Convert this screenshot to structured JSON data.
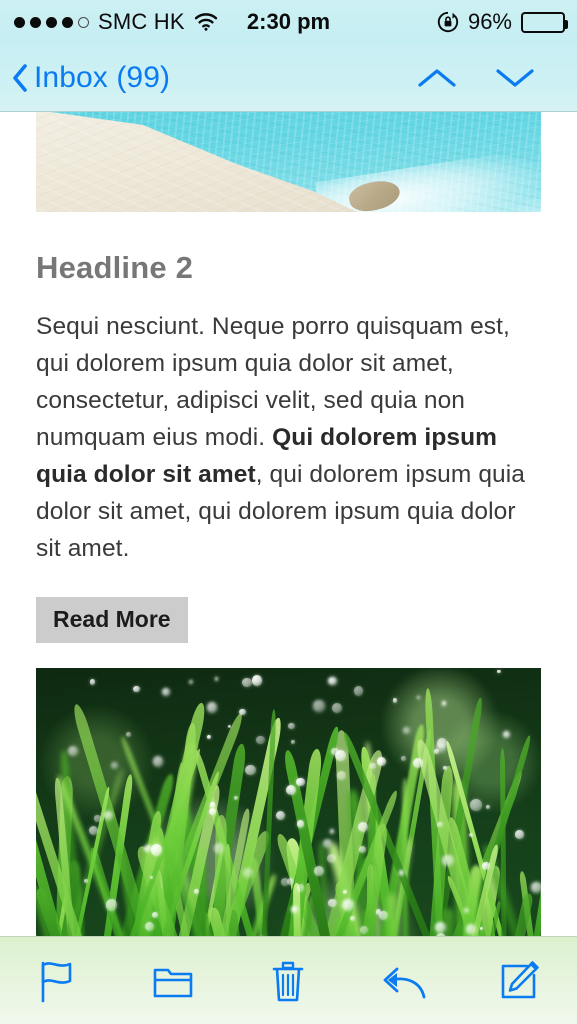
{
  "status_bar": {
    "signal_dots_total": 5,
    "signal_dots_filled": 4,
    "carrier": "SMC HK",
    "wifi_icon": "wifi-icon",
    "time": "2:30 pm",
    "rotation_lock_icon": "rotation-lock-icon",
    "battery_percent": "96%",
    "battery_icon": "battery-full-icon"
  },
  "nav_bar": {
    "back_icon": "chevron-left-icon",
    "back_label": "Inbox (99)",
    "previous_message_icon": "chevron-up-icon",
    "next_message_icon": "chevron-down-icon",
    "tint_color": "#0a7bf0"
  },
  "message": {
    "hero_image_alt": "beach-sand-turquoise-water-photo",
    "headline": "Headline 2",
    "body_part1": "Sequi nesciunt. Neque porro quisquam est, qui dolorem ipsum quia dolor sit amet, consectetur, adipisci velit, sed quia non numquam eius modi. ",
    "body_bold": "Qui dolorem ipsum quia dolor sit amet",
    "body_part2": ", qui dolorem ipsum quia dolor sit amet, qui dolorem ipsum quia dolor sit amet.",
    "read_more_label": "Read More",
    "footer_image_alt": "dewy-green-grass-photo",
    "headline_color": "#777777",
    "body_color": "#3a3a3a",
    "button_background": "#cccccc"
  },
  "toolbar": {
    "items": [
      {
        "name": "flag-icon",
        "label": "Flag"
      },
      {
        "name": "folder-icon",
        "label": "Move to Folder"
      },
      {
        "name": "trash-icon",
        "label": "Delete"
      },
      {
        "name": "reply-icon",
        "label": "Reply"
      },
      {
        "name": "compose-icon",
        "label": "Compose"
      }
    ],
    "tint_color": "#0a7bf0"
  }
}
